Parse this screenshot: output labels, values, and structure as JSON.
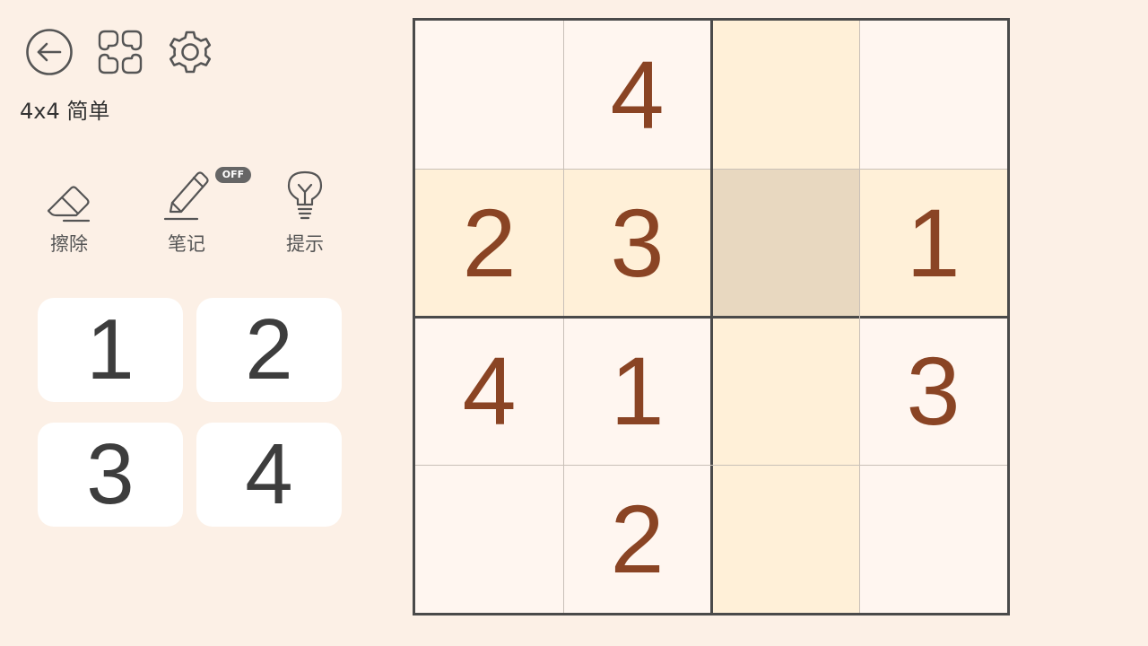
{
  "header": {
    "back_icon": "arrow-left-circle-icon",
    "layout_icon": "layout-grid-icon",
    "settings_icon": "gear-icon",
    "mode_label": "4x4 简单"
  },
  "tools": {
    "erase_label": "擦除",
    "notes_label": "笔记",
    "notes_badge": "OFF",
    "hint_label": "提示"
  },
  "numpad": {
    "keys": [
      "1",
      "2",
      "3",
      "4"
    ]
  },
  "board": {
    "size": 4,
    "selected": {
      "row": 1,
      "col": 2
    },
    "rows": [
      [
        "",
        "4",
        "",
        ""
      ],
      [
        "2",
        "3",
        "",
        "1"
      ],
      [
        "4",
        "1",
        "",
        "3"
      ],
      [
        "",
        "2",
        "",
        ""
      ]
    ]
  },
  "colors": {
    "background": "#fcf0e6",
    "cell": "#fff6f0",
    "highlight": "#fff0d8",
    "selected": "#e8d8c0",
    "given_digit": "#8a4424",
    "numpad_digit": "#3d3d3d"
  }
}
